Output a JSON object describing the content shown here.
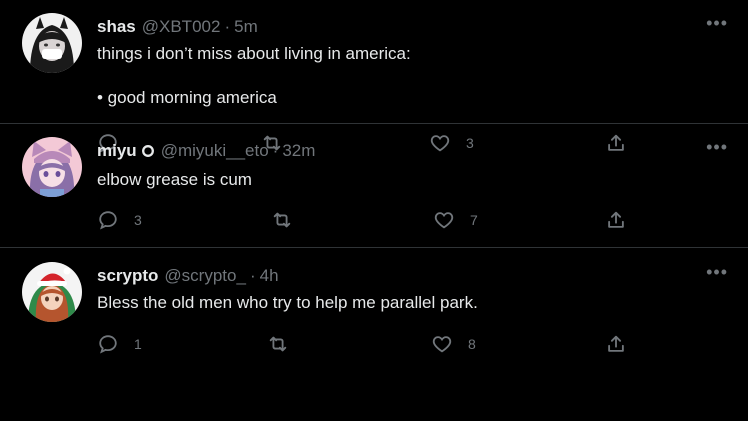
{
  "tweets": [
    {
      "name": "shas",
      "verified": false,
      "handle": "@XBT002",
      "dot": "·",
      "time": "5m",
      "text": "things i don’t miss about living in america:\n\n• good morning america",
      "reply_count": "",
      "retweet_count": "",
      "like_count": "3",
      "more": "•••",
      "avatar_colors": {
        "bg": "#f1f1f1",
        "hair": "#1a1a1a",
        "skin": "#d9d4d4",
        "mask": "#ffffff"
      }
    },
    {
      "name": "miyu",
      "verified": true,
      "handle": "@miyuki__eto",
      "dot": "·",
      "time": "32m",
      "text": "elbow grease is cum",
      "reply_count": "3",
      "retweet_count": "",
      "like_count": "7",
      "more": "•••",
      "avatar_colors": {
        "bg": "#f3c9d6",
        "hair": "#8a6fa8",
        "skin": "#f6dfe6",
        "hat": "#b889b9"
      }
    },
    {
      "name": "scrypto",
      "verified": false,
      "handle": "@scrypto_",
      "dot": "·",
      "time": "4h",
      "text": "Bless the old men who try to help me parallel park.",
      "reply_count": "1",
      "retweet_count": "",
      "like_count": "8",
      "more": "•••",
      "avatar_colors": {
        "bg": "#f4f4f4",
        "hair": "#b5552e",
        "skin": "#f4d3bd",
        "hat": "#d4232a",
        "hood": "#2f8a4a"
      }
    }
  ],
  "colors": {
    "text": "#e7e9ea",
    "muted": "#71767b",
    "divider": "#2f3336",
    "background": "#000000"
  },
  "icons": [
    "reply-icon",
    "retweet-icon",
    "like-icon",
    "share-icon",
    "more-icon",
    "verified-icon"
  ]
}
